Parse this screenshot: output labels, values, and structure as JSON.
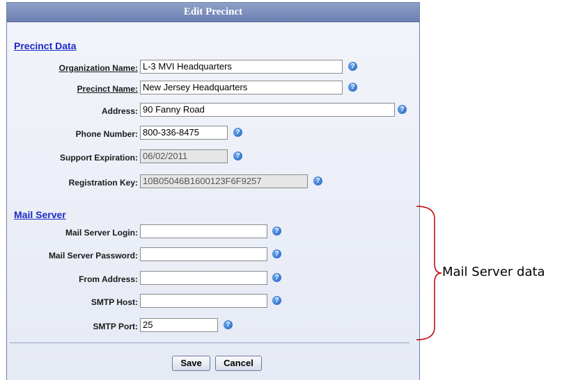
{
  "dialog": {
    "title": "Edit Precinct"
  },
  "precinct_section": {
    "heading": "Precinct Data",
    "fields": [
      {
        "label": "Organization Name:",
        "value": "L-3 MVI Headquarters"
      },
      {
        "label": "Precinct Name:",
        "value": "New Jersey Headquarters"
      },
      {
        "label": "Address:",
        "value": "90 Fanny Road"
      },
      {
        "label": "Phone Number:",
        "value": "800-336-8475"
      },
      {
        "label": "Support Expiration:",
        "value": "06/02/2011"
      },
      {
        "label": "Registration Key:",
        "value": "10B05046B1600123F6F9257"
      }
    ]
  },
  "mail_section": {
    "heading": "Mail Server",
    "fields": [
      {
        "label": "Mail Server Login:",
        "value": ""
      },
      {
        "label": "Mail Server Password:",
        "value": ""
      },
      {
        "label": "From Address:",
        "value": ""
      },
      {
        "label": "SMTP Host:",
        "value": ""
      },
      {
        "label": "SMTP Port:",
        "value": "25"
      }
    ]
  },
  "help_icon_glyph": "?",
  "buttons": {
    "save": "Save",
    "cancel": "Cancel"
  },
  "annotation": {
    "text": "Mail Server data",
    "bracket_color": "#c00000"
  }
}
